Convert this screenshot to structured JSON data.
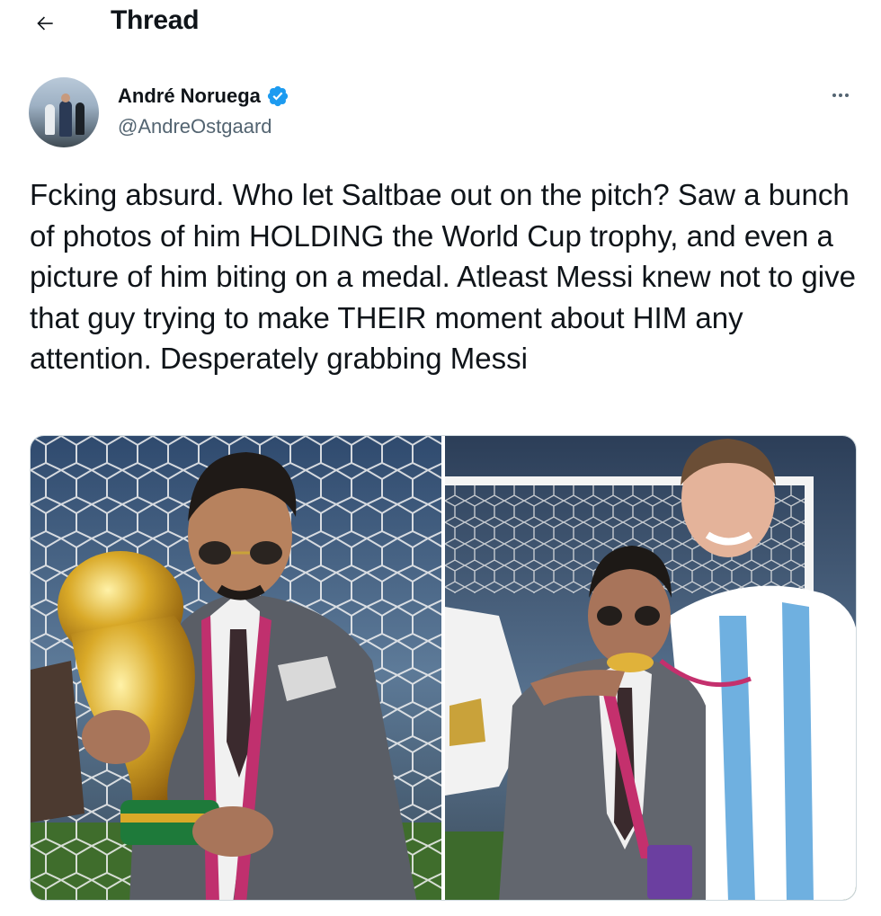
{
  "header": {
    "back_icon": "arrow-left-icon",
    "title": "Thread"
  },
  "tweet": {
    "author_name": "André Noruega",
    "author_handle": "@AndreOstgaard",
    "verified_icon": "verified-badge-icon",
    "more_icon": "more-options-icon",
    "text": "Fcking absurd. Who let Saltbae out on the pitch? Saw a bunch of photos of him HOLDING the World Cup trophy, and even a picture of him biting on a medal. Atleast Messi knew not to give that guy trying to make THEIR moment about HIM any attention. Desperately grabbing Messi",
    "media": [
      {
        "description": "photo-trophy"
      },
      {
        "description": "photo-medal"
      }
    ]
  },
  "colors": {
    "text": "#0f1419",
    "secondary": "#536471",
    "verified": "#1d9bf0",
    "border": "#cfd9de"
  }
}
